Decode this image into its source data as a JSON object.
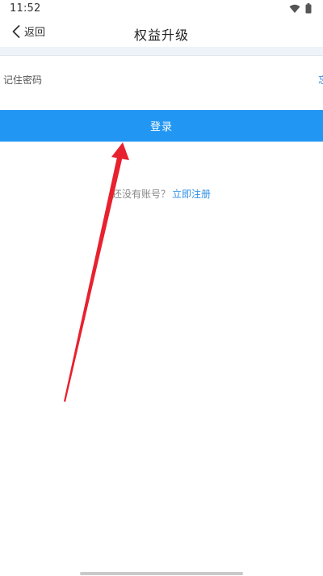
{
  "status_bar": {
    "time": "11:52",
    "icons": [
      "wifi-icon",
      "battery-icon"
    ]
  },
  "header": {
    "back_label": "返回",
    "title": "权益升级"
  },
  "form": {
    "remember_label": "记住密码",
    "forgot_partial": "忘",
    "login_label": "登录"
  },
  "register": {
    "prompt": "还没有账号？",
    "link": "立即注册"
  },
  "colors": {
    "primary": "#2196f3",
    "link": "#2f8fe8",
    "band": "#eef3f9",
    "annotation_arrow": "#e8212e"
  }
}
